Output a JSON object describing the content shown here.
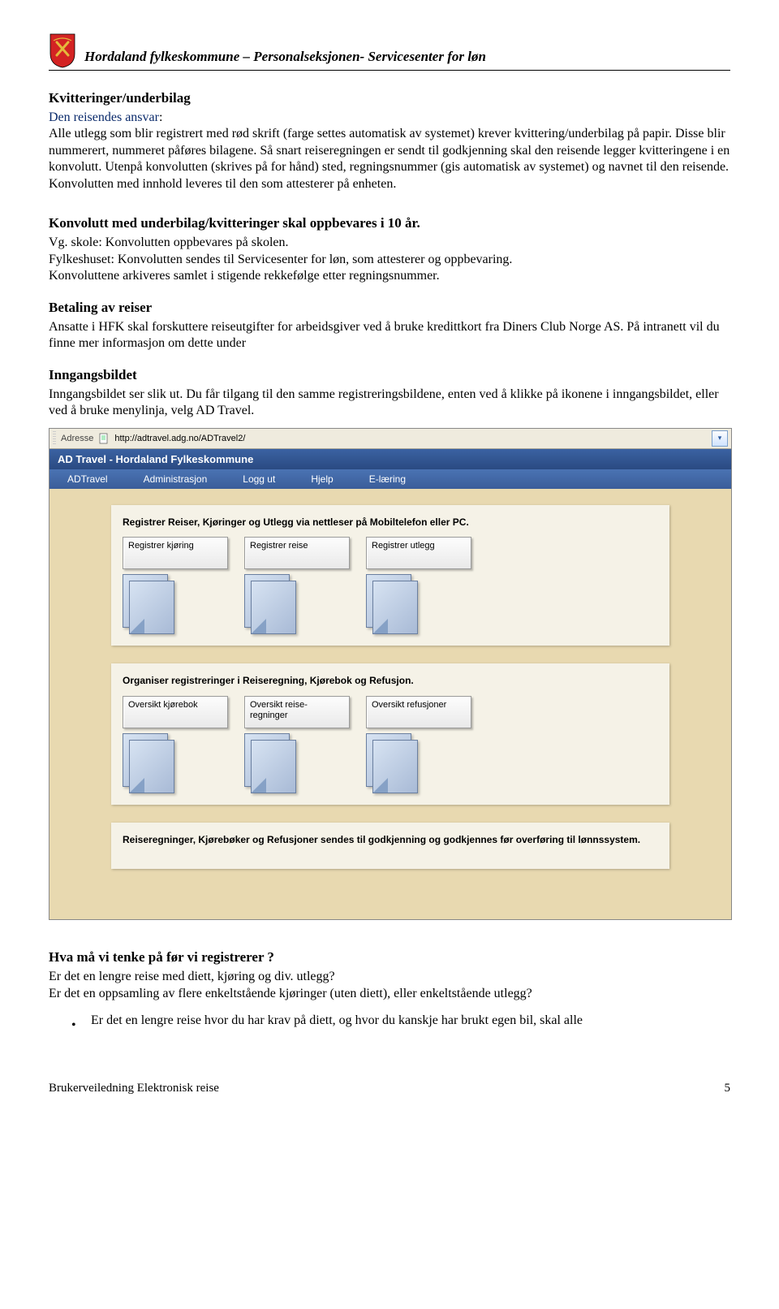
{
  "header": {
    "text": "Hordaland fylkeskommune – Personalseksjonen- Servicesenter for løn"
  },
  "content": {
    "h1": "Kvitteringer/underbilag",
    "p1_lead": "Den reisendes ansvar",
    "p1_colon": ":",
    "p1_body": "Alle utlegg som blir registrert med rød skrift (farge settes automatisk av systemet) krever kvittering/underbilag på papir. Disse blir nummerert, nummeret påføres bilagene. Så snart reiseregningen er sendt til godkjenning skal den reisende legger kvitteringene i en konvolutt. Utenpå konvolutten (skrives på for hånd) sted, regningsnummer (gis automatisk av systemet) og navnet til den reisende. Konvolutten med innhold leveres til den som attesterer på enheten.",
    "h2": "Konvolutt med underbilag/kvitteringer skal oppbevares i 10 år.",
    "p2a": "Vg. skole: Konvolutten oppbevares på skolen.",
    "p2b": "Fylkeshuset: Konvolutten sendes til Servicesenter for løn, som attesterer og oppbevaring.",
    "p2c": "Konvoluttene arkiveres samlet i stigende rekkefølge etter regningsnummer.",
    "h3": "Betaling av reiser",
    "p3": "Ansatte i HFK skal forskuttere reiseutgifter for arbeidsgiver ved å bruke kredittkort fra Diners Club Norge AS. På intranett vil du finne mer informasjon om dette under",
    "h4": "Inngangsbildet",
    "p4": "Inngangsbildet ser slik ut. Du får tilgang til den samme registreringsbildene, enten ved å klikke på ikonene i inngangsbildet, eller ved å bruke menylinja, velg AD Travel.",
    "h5": "Hva må vi tenke på før vi registrerer ?",
    "p5a": "Er det en lengre reise med diett, kjøring og div. utlegg?",
    "p5b": "Er det en oppsamling av flere enkeltstående kjøringer (uten diett), eller enkeltstående utlegg?",
    "bullet1": "Er det en lengre reise hvor du har krav på diett, og hvor du kanskje har brukt egen bil, skal alle"
  },
  "app": {
    "addressbar": {
      "label": "Adresse",
      "url": "http://adtravel.adg.no/ADTravel2/"
    },
    "title": "AD Travel        - Hordaland Fylkeskommune",
    "menu": [
      "ADTravel",
      "Administrasjon",
      "Logg ut",
      "Hjelp",
      "E-læring"
    ],
    "panels": [
      {
        "title": "Registrer Reiser, Kjøringer og Utlegg via nettleser på Mobiltelefon eller PC.",
        "cards": [
          "Registrer kjøring",
          "Registrer reise",
          "Registrer utlegg"
        ]
      },
      {
        "title": "Organiser registreringer i Reiseregning, Kjørebok og Refusjon.",
        "cards": [
          "Oversikt kjørebok",
          "Oversikt reise-regninger",
          "Oversikt refusjoner"
        ]
      },
      {
        "title": "Reiseregninger, Kjørebøker og Refusjoner sendes til godkjenning og godkjennes før overføring til lønnssystem.",
        "cards": []
      }
    ]
  },
  "footer": {
    "left": "Brukerveiledning Elektronisk reise",
    "right": "5"
  }
}
